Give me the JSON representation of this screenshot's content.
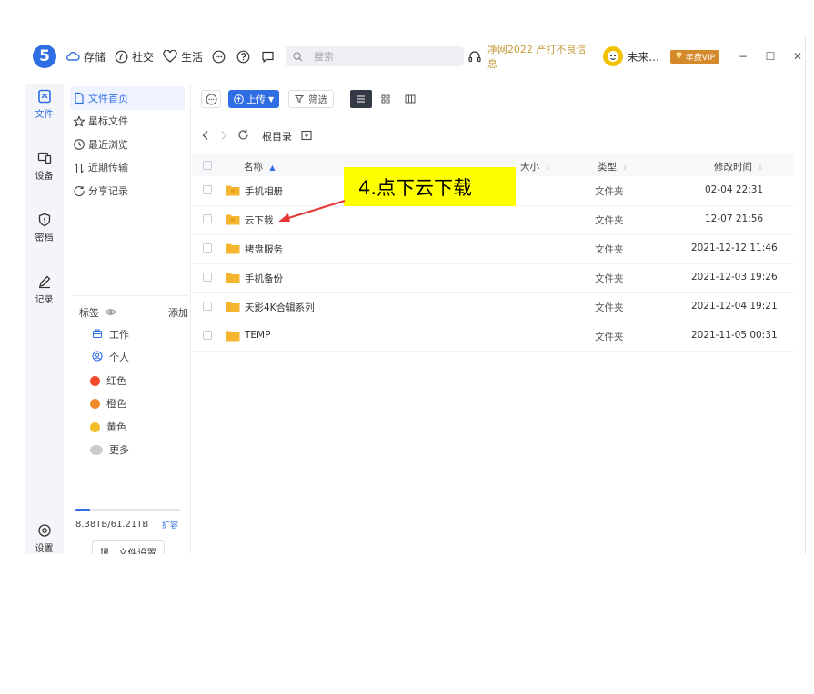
{
  "topbar": {
    "logo_text": "5",
    "nav": [
      {
        "label": "存储",
        "icon": "cloud-icon"
      },
      {
        "label": "社交",
        "icon": "compass-icon"
      },
      {
        "label": "生活",
        "icon": "heart-icon"
      }
    ],
    "search_placeholder": "搜索",
    "promo": "净网2022 严打不良信息",
    "username": "未来...",
    "vip_label": "年费VIP",
    "window_controls": [
      "−",
      "☐",
      "✕"
    ]
  },
  "rail": [
    {
      "label": "文件",
      "icon": "file-icon",
      "active": true
    },
    {
      "label": "设备",
      "icon": "device-icon"
    },
    {
      "label": "密档",
      "icon": "shield-icon"
    },
    {
      "label": "记录",
      "icon": "pen-icon"
    },
    {
      "label": "设置",
      "icon": "gear-icon"
    }
  ],
  "sidebar": {
    "items": [
      {
        "label": "文件首页",
        "icon": "doc-icon",
        "active": true
      },
      {
        "label": "星标文件",
        "icon": "star-icon"
      },
      {
        "label": "最近浏览",
        "icon": "clock-icon"
      },
      {
        "label": "近期传输",
        "icon": "transfer-icon"
      },
      {
        "label": "分享记录",
        "icon": "share-icon"
      }
    ],
    "tags_title": "标签",
    "tags_add": "添加",
    "tags": [
      {
        "label": "工作",
        "icon": "briefcase-icon"
      },
      {
        "label": "个人",
        "icon": "person-icon"
      },
      {
        "label": "红色",
        "color": "#f04a2a"
      },
      {
        "label": "橙色",
        "color": "#f08a2a"
      },
      {
        "label": "黄色",
        "color": "#f5bd2a"
      },
      {
        "label": "更多",
        "color": "#cccccc"
      }
    ],
    "storage_used_fraction": 0.137,
    "storage_text": "8.38TB/61.21TB",
    "storage_expand": "扩容",
    "file_settings": "文件设置"
  },
  "toolbar": {
    "upload": "上传",
    "filter": "筛选"
  },
  "breadcrumb": {
    "root": "根目录"
  },
  "table": {
    "headers": {
      "name": "名称",
      "size": "大小",
      "type": "类型",
      "modified": "修改时间"
    },
    "rows": [
      {
        "name": "手机相册",
        "type": "文件夹",
        "modified": "02-04 22:31",
        "shared": true
      },
      {
        "name": "云下载",
        "type": "文件夹",
        "modified": "12-07 21:56",
        "shared": true
      },
      {
        "name": "拷盘服务",
        "type": "文件夹",
        "modified": "2021-12-12 11:46"
      },
      {
        "name": "手机备份",
        "type": "文件夹",
        "modified": "2021-12-03 19:26"
      },
      {
        "name": "天影4K合辑系列",
        "type": "文件夹",
        "modified": "2021-12-04 19:21"
      },
      {
        "name": "TEMP",
        "type": "文件夹",
        "modified": "2021-11-05 00:31"
      }
    ]
  },
  "annotation": {
    "text": "4.点下云下载",
    "color": "#ffff00",
    "arrow_color": "#e53935"
  }
}
